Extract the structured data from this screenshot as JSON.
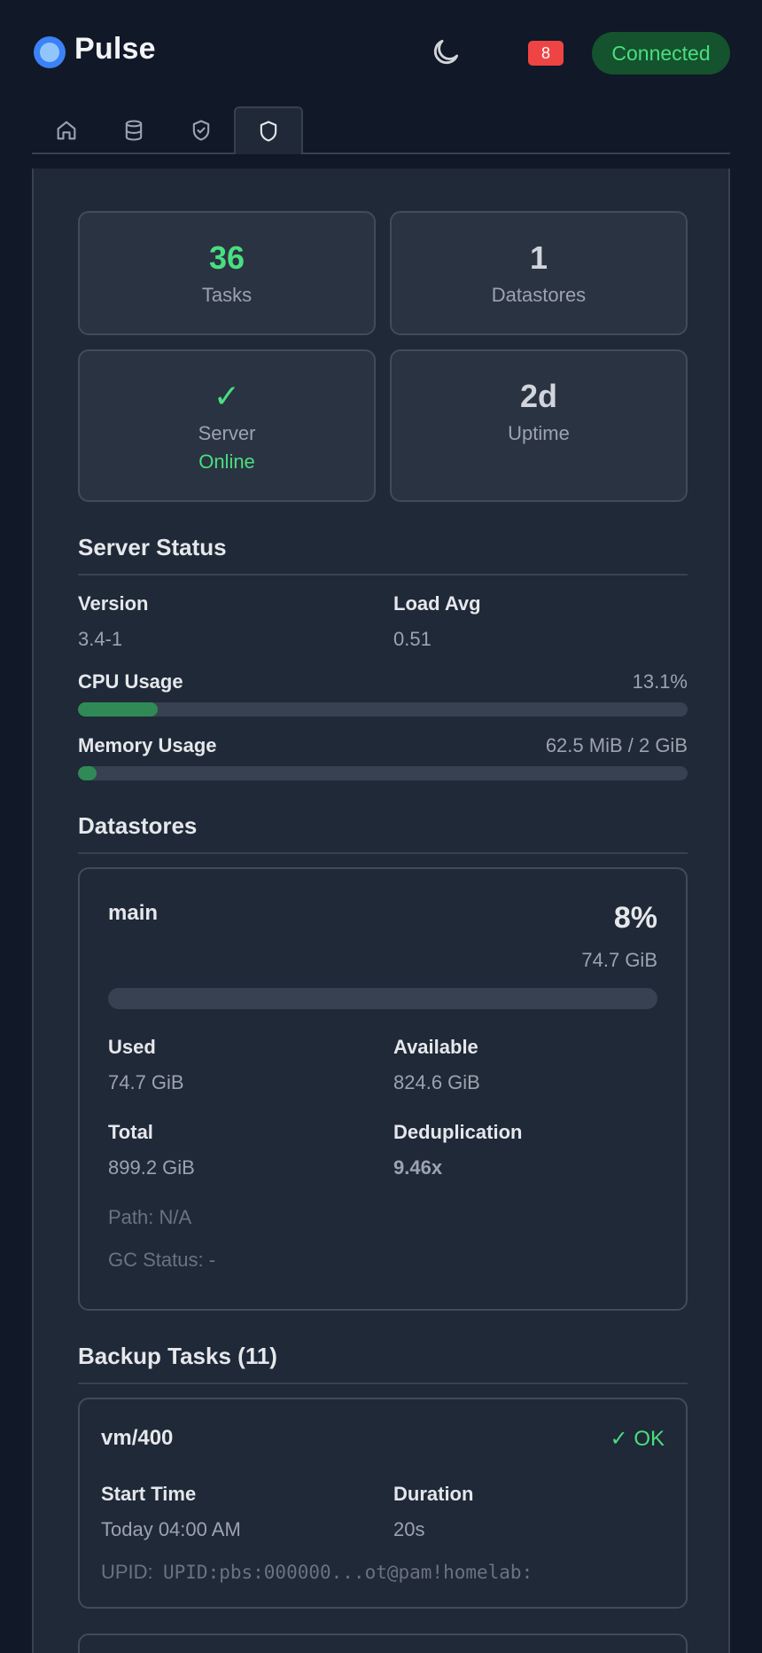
{
  "header": {
    "app_name": "Pulse",
    "theme_icon": "moon-icon",
    "alert_count": "8",
    "connection_status": "Connected"
  },
  "tabs": [
    {
      "icon": "home-icon"
    },
    {
      "icon": "database-icon"
    },
    {
      "icon": "shield-check-icon"
    },
    {
      "icon": "shield-icon",
      "active": true
    }
  ],
  "stats": {
    "tasks": {
      "value": "36",
      "label": "Tasks"
    },
    "datastores": {
      "value": "1",
      "label": "Datastores"
    },
    "server": {
      "value": "✓",
      "label": "Server",
      "status": "Online"
    },
    "uptime": {
      "value": "2d",
      "label": "Uptime"
    }
  },
  "server_status": {
    "title": "Server Status",
    "version_label": "Version",
    "version": "3.4-1",
    "load_label": "Load Avg",
    "load": "0.51",
    "cpu_label": "CPU Usage",
    "cpu_value": "13.1%",
    "cpu_fraction": 0.131,
    "memory_label": "Memory Usage",
    "memory_value": "62.5 MiB / 2 GiB",
    "memory_fraction": 0.03
  },
  "datastores": {
    "title": "Datastores",
    "items": [
      {
        "name": "main",
        "percent": "8%",
        "used_short": "74.7 GiB",
        "usage_fraction": 0.0,
        "used_label": "Used",
        "used": "74.7 GiB",
        "available_label": "Available",
        "available": "824.6 GiB",
        "total_label": "Total",
        "total": "899.2 GiB",
        "dedup_label": "Deduplication",
        "dedup": "9.46x",
        "path": "Path: N/A",
        "gc_status": "GC Status: -"
      }
    ]
  },
  "backup_tasks": {
    "title": "Backup Tasks (11)",
    "items": [
      {
        "name": "vm/400",
        "status": "✓ OK",
        "start_label": "Start Time",
        "start": "Today 04:00 AM",
        "duration_label": "Duration",
        "duration": "20s",
        "upid_label": "UPID:",
        "upid": "UPID:pbs:000000...ot@pam!homelab:"
      }
    ]
  },
  "colors": {
    "background": "#111827",
    "panel": "#1f2937",
    "accent_green": "#4ade80",
    "alert_red": "#ef4444",
    "brand_blue": "#3b82f6"
  }
}
